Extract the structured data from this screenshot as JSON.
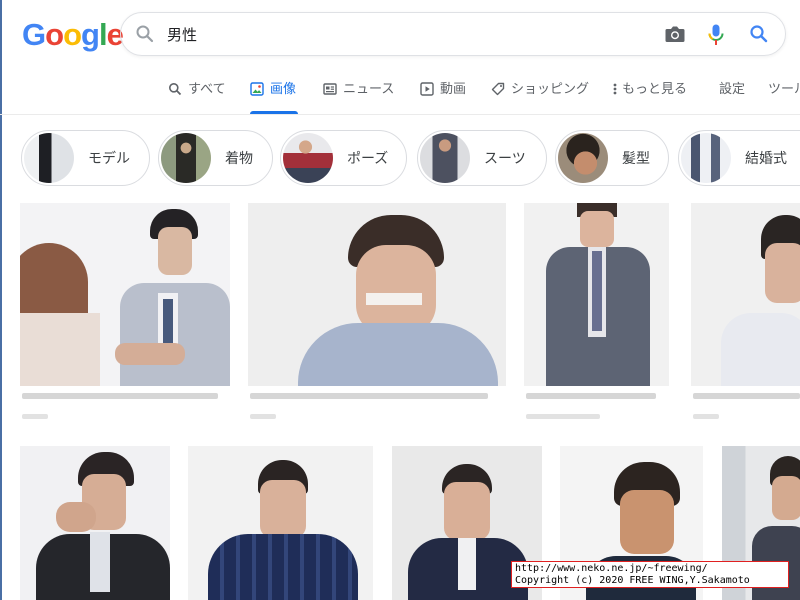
{
  "logo": {
    "letters": [
      "G",
      "o",
      "o",
      "g",
      "l",
      "e"
    ]
  },
  "search": {
    "query": "男性",
    "icons": [
      "search-icon",
      "camera-icon",
      "mic-icon",
      "search-submit-icon"
    ]
  },
  "tabs": [
    {
      "label": "すべて",
      "icon": "search-icon",
      "active": false
    },
    {
      "label": "画像",
      "icon": "image-icon",
      "active": true
    },
    {
      "label": "ニュース",
      "icon": "news-icon",
      "active": false
    },
    {
      "label": "動画",
      "icon": "play-icon",
      "active": false
    },
    {
      "label": "ショッピング",
      "icon": "tag-icon",
      "active": false
    },
    {
      "label": "もっと見る",
      "icon": "more-vert-icon",
      "active": false
    },
    {
      "label": "設定",
      "icon": "",
      "active": false
    },
    {
      "label": "ツール",
      "icon": "",
      "active": false
    }
  ],
  "chips": [
    {
      "label": "モデル"
    },
    {
      "label": "着物"
    },
    {
      "label": "ポーズ"
    },
    {
      "label": "スーツ"
    },
    {
      "label": "髪型"
    },
    {
      "label": "結婚式"
    }
  ],
  "results_row1": [
    "result-image",
    "result-image",
    "result-image",
    "result-image"
  ],
  "results_row2": [
    "result-image",
    "result-image",
    "result-image",
    "result-image",
    "result-image"
  ],
  "watermark": {
    "line1": "http://www.neko.ne.jp/~freewing/",
    "line2": "Copyright (c) 2020 FREE WING,Y.Sakamoto"
  },
  "colors": {
    "accent": "#1a73e8",
    "logo_blue": "#4285f4",
    "logo_red": "#ea4335",
    "logo_yellow": "#fbbc05",
    "logo_green": "#34a853"
  }
}
